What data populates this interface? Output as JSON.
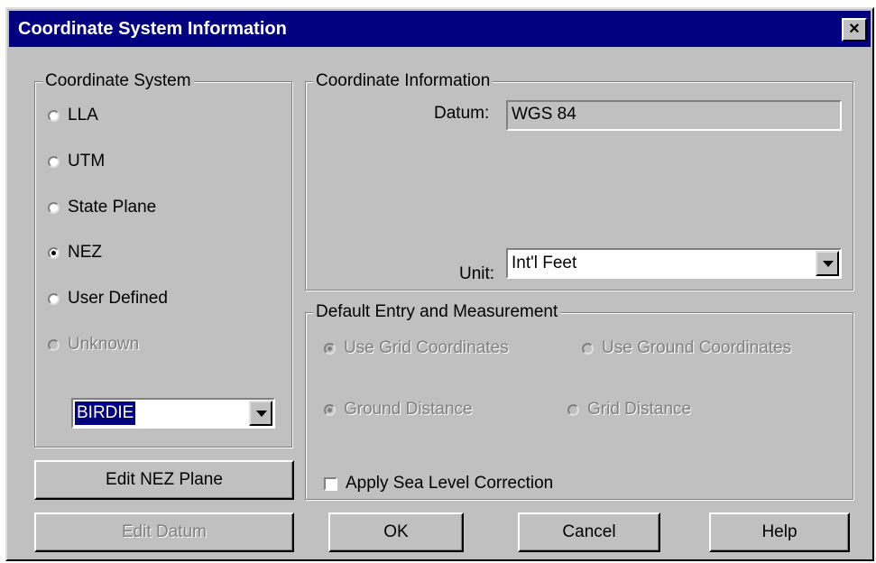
{
  "window": {
    "title": "Coordinate System Information",
    "close_glyph": "×"
  },
  "coordinate_system": {
    "legend": "Coordinate System",
    "options": [
      {
        "label": "LLA",
        "checked": false,
        "disabled": false
      },
      {
        "label": "UTM",
        "checked": false,
        "disabled": false
      },
      {
        "label": "State Plane",
        "checked": false,
        "disabled": false
      },
      {
        "label": "NEZ",
        "checked": true,
        "disabled": false
      },
      {
        "label": "User Defined",
        "checked": false,
        "disabled": false
      },
      {
        "label": "Unknown",
        "checked": false,
        "disabled": true
      }
    ],
    "plane_select": {
      "value": "BIRDIE"
    }
  },
  "coordinate_info": {
    "legend": "Coordinate Information",
    "datum_label": "Datum:",
    "datum_value": "WGS 84",
    "unit_label": "Unit:",
    "unit_value": "Int'l Feet"
  },
  "default_entry": {
    "legend": "Default Entry and Measurement",
    "options": [
      {
        "label": "Use Grid Coordinates",
        "checked": true,
        "disabled": true
      },
      {
        "label": "Use Ground Coordinates",
        "checked": false,
        "disabled": true
      },
      {
        "label": "Ground Distance",
        "checked": true,
        "disabled": true
      },
      {
        "label": "Grid Distance",
        "checked": false,
        "disabled": true
      }
    ],
    "sea_level_label": "Apply Sea Level Correction",
    "sea_level_checked": false
  },
  "buttons": {
    "edit_nez": "Edit NEZ Plane",
    "edit_datum": "Edit Datum",
    "ok": "OK",
    "cancel": "Cancel",
    "help": "Help"
  }
}
